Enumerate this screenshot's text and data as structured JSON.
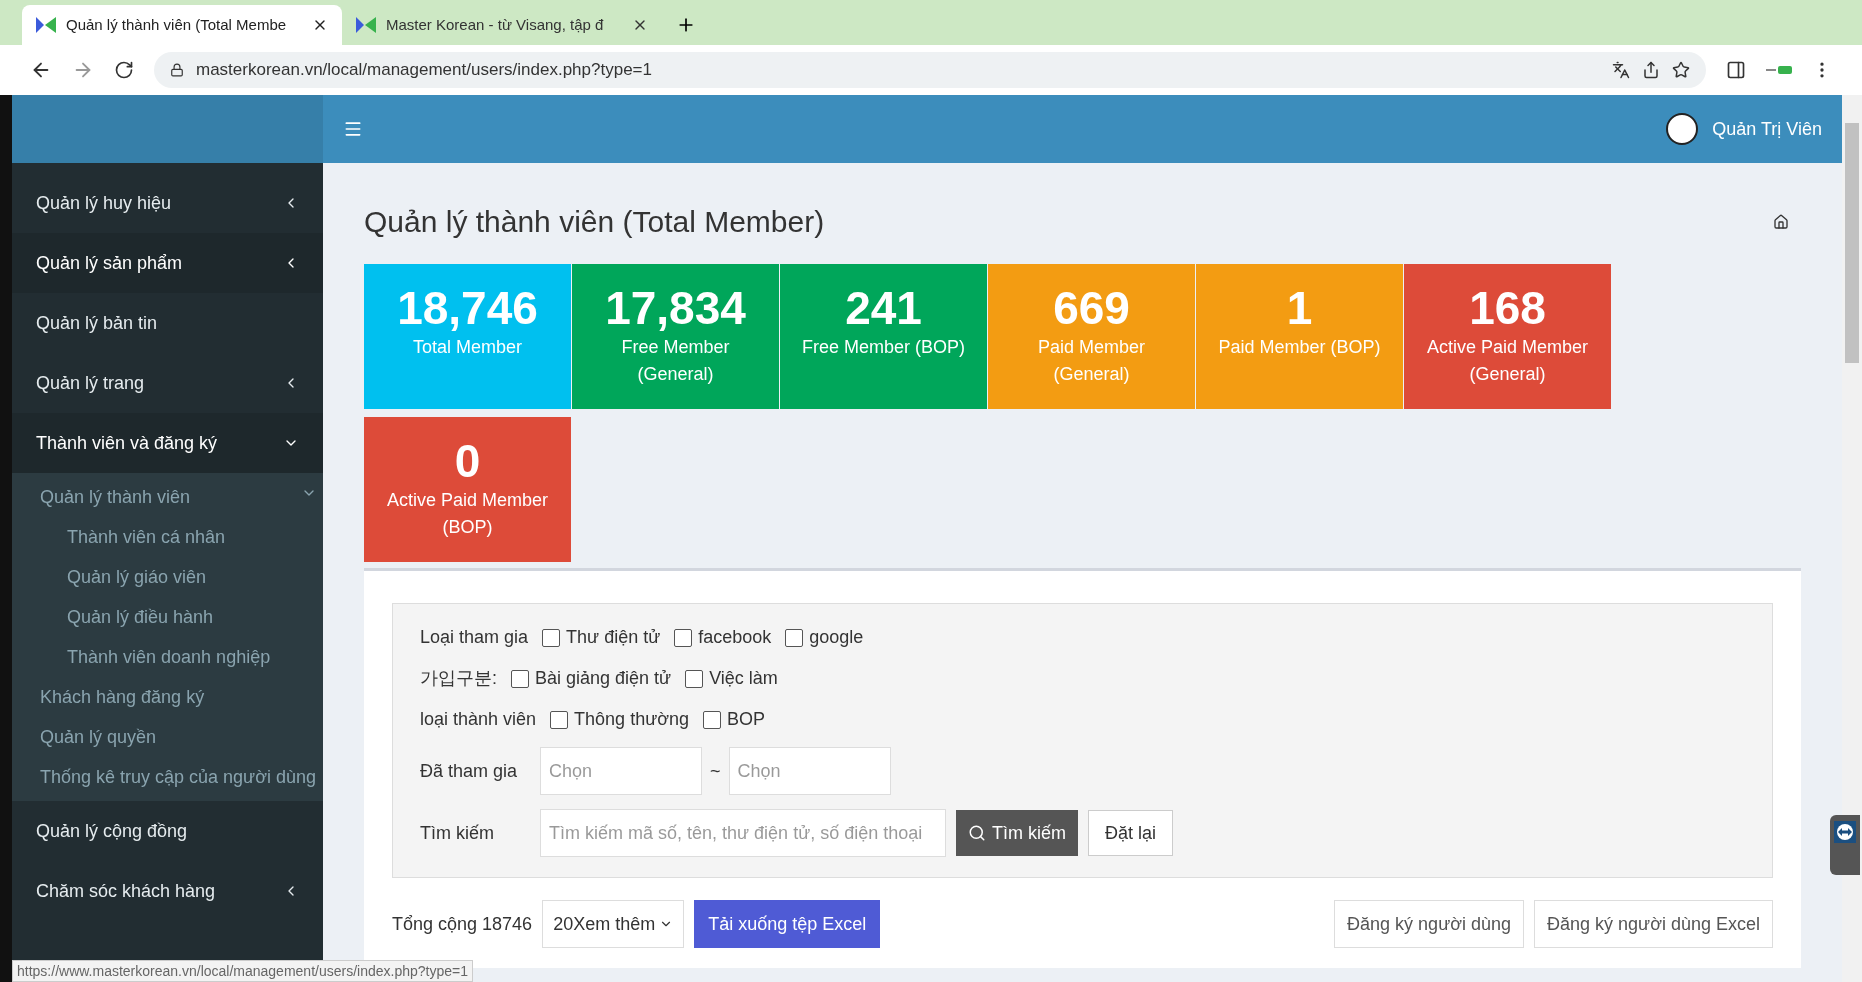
{
  "browser": {
    "tabs": [
      {
        "title": "Quản lý thành viên (Total Membe",
        "selected": true
      },
      {
        "title": "Master Korean - từ Visang, tập đ",
        "selected": false
      }
    ],
    "url": "masterkorean.vn/local/management/users/index.php?type=1",
    "status_url": "https://www.masterkorean.vn/local/management/users/index.php?type=1"
  },
  "header": {
    "user": "Quản Trị Viên"
  },
  "sidebar": {
    "items": [
      {
        "label": "Quản lý huy hiệu",
        "active": false,
        "expanded": false
      },
      {
        "label": "Quản lý sản phẩm",
        "active": true,
        "expanded": false
      },
      {
        "label": "Quản lý bản tin",
        "active": false
      },
      {
        "label": "Quản lý trang",
        "active": false,
        "expanded": false
      },
      {
        "label": "Thành viên và đăng ký",
        "active": true,
        "expanded": true,
        "children": [
          {
            "label": "Quản lý thành viên",
            "expanded": true,
            "children": [
              {
                "label": "Thành viên cá nhân"
              },
              {
                "label": "Quản lý giáo viên"
              },
              {
                "label": "Quản lý điều hành"
              },
              {
                "label": "Thành viên doanh nghiệp"
              }
            ]
          },
          {
            "label": "Khách hàng đăng ký"
          },
          {
            "label": "Quản lý quyền"
          },
          {
            "label": "Thống kê truy cập của người dùng"
          }
        ]
      },
      {
        "label": "Quản lý cộng đồng",
        "active": false
      },
      {
        "label": "Chăm sóc khách hàng",
        "active": false,
        "expanded": false
      }
    ]
  },
  "page_title": "Quản lý thành viên (Total Member)",
  "tiles": [
    {
      "value": "18,746",
      "label": "Total Member",
      "color": "#00c0ef"
    },
    {
      "value": "17,834",
      "label": "Free Member (General)",
      "color": "#00a65a"
    },
    {
      "value": "241",
      "label": "Free Member (BOP)",
      "color": "#00a65a"
    },
    {
      "value": "669",
      "label": "Paid Member (General)",
      "color": "#f39c12"
    },
    {
      "value": "1",
      "label": "Paid Member (BOP)",
      "color": "#f39c12"
    },
    {
      "value": "168",
      "label": "Active Paid Member (General)",
      "color": "#dd4b39"
    },
    {
      "value": "0",
      "label": "Active Paid Member (BOP)",
      "color": "#dd4b39"
    }
  ],
  "filters": {
    "checkbox_rows": [
      {
        "label": "Loại tham gia",
        "options": [
          {
            "label": "Thư điện tử",
            "checked": false
          },
          {
            "label": "facebook",
            "checked": false
          },
          {
            "label": "google",
            "checked": false
          }
        ]
      },
      {
        "label": "가입구분:",
        "options": [
          {
            "label": "Bài giảng điện tử",
            "checked": false
          },
          {
            "label": "Việc làm",
            "checked": false
          }
        ]
      },
      {
        "label": "loại thành viên",
        "options": [
          {
            "label": "Thông thường",
            "checked": false
          },
          {
            "label": "BOP",
            "checked": false
          }
        ]
      }
    ],
    "date": {
      "label": "Đã tham gia",
      "from_placeholder": "Chọn",
      "separator": "~",
      "to_placeholder": "Chọn"
    },
    "search": {
      "label": "Tìm kiếm",
      "placeholder": "Tìm kiếm mã số, tên, thư điện tử, số điện thoại",
      "button": "Tìm kiếm",
      "reset": "Đặt lại"
    }
  },
  "footer": {
    "total": "Tổng cộng 18746",
    "page_size": "20Xem thêm",
    "excel": "Tải xuống tệp Excel",
    "register": "Đăng ký người dùng",
    "register_excel": "Đăng ký người dùng Excel"
  }
}
